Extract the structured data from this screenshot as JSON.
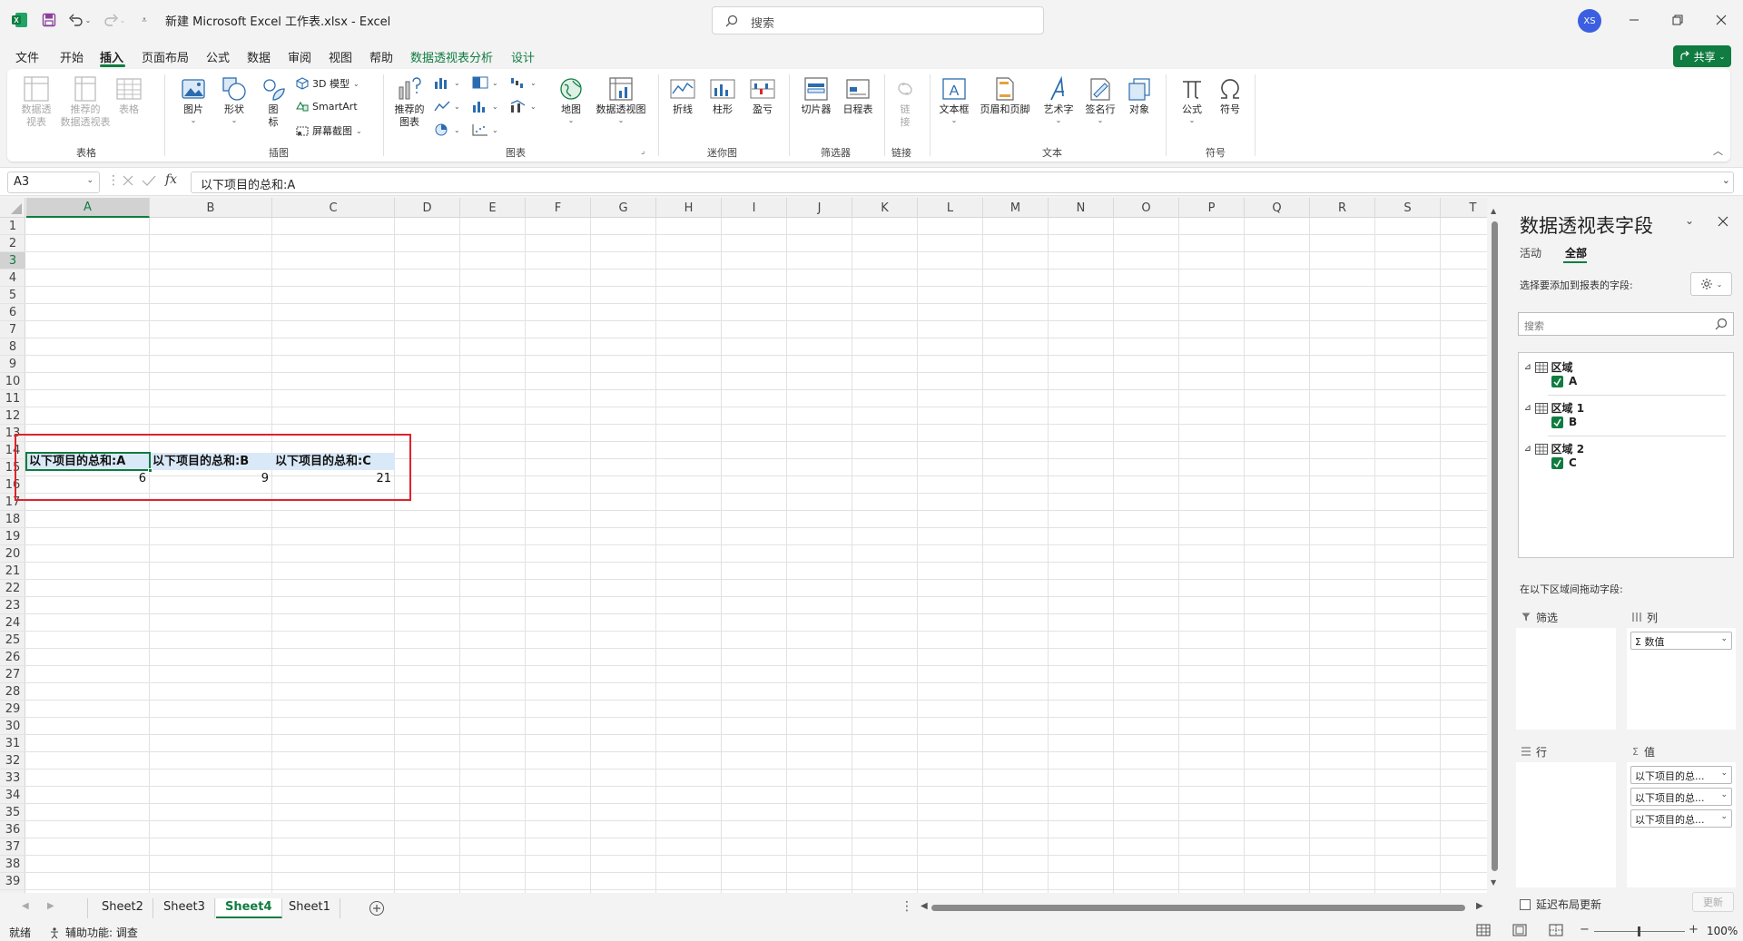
{
  "titlebar": {
    "doc_title": "新建 Microsoft Excel 工作表.xlsx  -  Excel",
    "search_placeholder": "搜索",
    "avatar_initials": "XS"
  },
  "menu": {
    "tabs": [
      "文件",
      "开始",
      "插入",
      "页面布局",
      "公式",
      "数据",
      "审阅",
      "视图",
      "帮助",
      "数据透视表分析",
      "设计"
    ],
    "active": "插入",
    "share": "共享"
  },
  "ribbon": {
    "table_group": {
      "pivot": "数据透\n视表",
      "recommended_pivot": "推荐的\n数据透视表",
      "table": "表格",
      "label": "表格"
    },
    "illustration_group": {
      "picture": "图片",
      "shapes": "形状",
      "icons": "图\n标",
      "model3d": "3D 模型",
      "smartart": "SmartArt",
      "screenshot": "屏幕截图",
      "label": "插图"
    },
    "chart_group": {
      "recommended": "推荐的\n图表",
      "map": "地图",
      "pivot_chart": "数据透视图",
      "label": "图表"
    },
    "sparkline_group": {
      "line": "折线",
      "column": "柱形",
      "winloss": "盈亏",
      "label": "迷你图"
    },
    "filter_group": {
      "slicer": "切片器",
      "timeline": "日程表",
      "label": "筛选器"
    },
    "link_group": {
      "link": "链\n接",
      "label": "链接"
    },
    "text_group": {
      "textbox": "文本框",
      "header_footer": "页眉和页脚",
      "wordart": "艺术字",
      "signature": "签名行",
      "object": "对象",
      "label": "文本"
    },
    "symbol_group": {
      "equation": "公式",
      "symbol": "符号",
      "label": "符号"
    }
  },
  "formula_bar": {
    "name_box": "A3",
    "fx": "fx",
    "formula": "以下项目的总和:A"
  },
  "grid": {
    "columns": [
      "A",
      "B",
      "C",
      "D",
      "E",
      "F",
      "G",
      "H",
      "I",
      "J",
      "K",
      "L",
      "M",
      "N",
      "O",
      "P",
      "Q",
      "R",
      "S",
      "T"
    ],
    "rows": [
      "1",
      "2",
      "3",
      "4",
      "5",
      "6",
      "7",
      "8",
      "9",
      "10",
      "11",
      "12",
      "13",
      "14",
      "15",
      "16",
      "17",
      "18",
      "19",
      "20",
      "21",
      "22",
      "23",
      "24",
      "25",
      "26",
      "27",
      "28",
      "29",
      "30",
      "31",
      "32",
      "33",
      "34",
      "35",
      "36",
      "37",
      "38",
      "39"
    ],
    "pivot_headers": [
      "以下项目的总和:A",
      "以下项目的总和:B",
      "以下项目的总和:C"
    ],
    "pivot_values": [
      "6",
      "9",
      "21"
    ]
  },
  "sheets": {
    "tabs": [
      "Sheet2",
      "Sheet3",
      "Sheet4",
      "Sheet1"
    ],
    "active": "Sheet4"
  },
  "status": {
    "ready": "就绪",
    "accessibility": "辅助功能: 调查",
    "zoom": "100%"
  },
  "pivot_pane": {
    "title": "数据透视表字段",
    "tabs": [
      "活动",
      "全部"
    ],
    "active_tab": "全部",
    "choose_label": "选择要添加到报表的字段:",
    "search_placeholder": "搜索",
    "groups": [
      {
        "name": "区域",
        "field": "A"
      },
      {
        "name": "区域 1",
        "field": "B"
      },
      {
        "name": "区域 2",
        "field": "C"
      }
    ],
    "drag_label": "在以下区域间拖动字段:",
    "filters_label": "筛选",
    "columns_label": "列",
    "rows_label": "行",
    "values_label": "值",
    "columns_items": [
      "Σ 数值"
    ],
    "values_items": [
      "以下项目的总...",
      "以下项目的总...",
      "以下项目的总..."
    ],
    "defer_label": "延迟布局更新",
    "update_label": "更新"
  },
  "colors": {
    "accent": "#107c41",
    "highlight_box": "#e0222d",
    "pivot_header_fill": "#dae9f8"
  }
}
